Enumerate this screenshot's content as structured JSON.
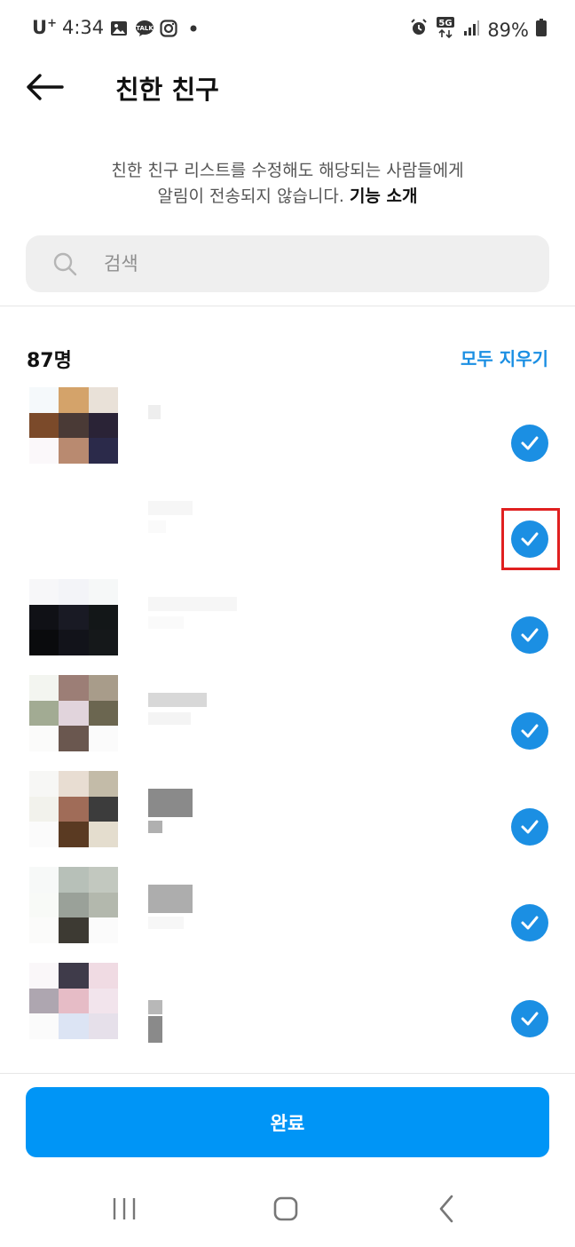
{
  "status_bar": {
    "carrier": "U",
    "carrier_sup": "+",
    "time": "4:34",
    "left_icons": [
      "gallery-icon",
      "kakaotalk-icon",
      "instagram-icon",
      "dot-icon"
    ],
    "right_icons": [
      "alarm-icon",
      "5g-icon",
      "signal-icon"
    ],
    "battery": "89%"
  },
  "header": {
    "title": "친한 친구"
  },
  "info": {
    "line1": "친한 친구 리스트를 수정해도 해당되는 사람들에게",
    "line2": "알림이 전송되지 않습니다.",
    "link": "기능 소개"
  },
  "search": {
    "placeholder": "검색"
  },
  "list_header": {
    "count": "87명",
    "clear_all": "모두 지우기"
  },
  "friends": [
    {
      "checked": true
    },
    {
      "checked": true
    },
    {
      "checked": true
    },
    {
      "checked": true
    },
    {
      "checked": true
    },
    {
      "checked": true
    },
    {
      "checked": true
    }
  ],
  "footer": {
    "done_label": "완료"
  },
  "colors": {
    "accent": "#0095f6",
    "check": "#1b8fe3",
    "highlight": "#e02020"
  }
}
